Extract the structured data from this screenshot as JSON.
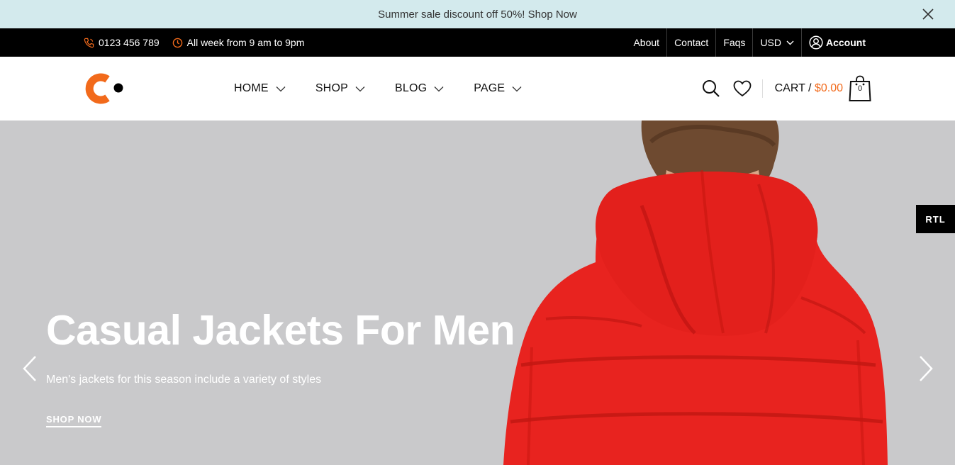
{
  "announcement": {
    "text": "Summer sale discount off 50%! Shop Now",
    "close_icon": "close-icon"
  },
  "topbar": {
    "phone": "0123 456 789",
    "hours": "All week from 9 am to 9pm",
    "links": {
      "about": "About",
      "contact": "Contact",
      "faqs": "Faqs"
    },
    "currency": "USD",
    "account": "Account"
  },
  "header": {
    "logo_icon": "c-logo",
    "nav": [
      {
        "label": "HOME"
      },
      {
        "label": "SHOP"
      },
      {
        "label": "BLOG"
      },
      {
        "label": "PAGE"
      }
    ],
    "cart_label": "CART /",
    "cart_amount": "$0.00",
    "cart_count": "0"
  },
  "hero": {
    "title": "Casual Jackets For Men",
    "subtitle": "Men's jackets for this season include a variety of styles",
    "cta": "SHOP NOW"
  },
  "rtl_label": "RTL",
  "colors": {
    "accent": "#f26a1b",
    "announce_bg": "#d3eaed",
    "topbar_bg": "#000000",
    "hero_bg": "#c9c9cb",
    "jacket_red": "#e8231f"
  }
}
